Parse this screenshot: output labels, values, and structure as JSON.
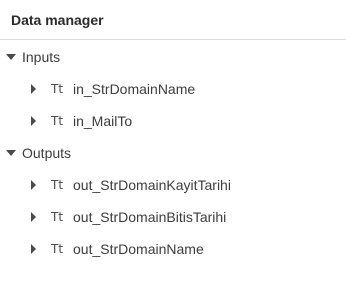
{
  "panel": {
    "title": "Data manager"
  },
  "groups": [
    {
      "label": "Inputs",
      "items": [
        {
          "type_icon": "Tt",
          "name": "in_StrDomainName"
        },
        {
          "type_icon": "Tt",
          "name": "in_MailTo"
        }
      ]
    },
    {
      "label": "Outputs",
      "items": [
        {
          "type_icon": "Tt",
          "name": "out_StrDomainKayitTarihi"
        },
        {
          "type_icon": "Tt",
          "name": "out_StrDomainBitisTarihi"
        },
        {
          "type_icon": "Tt",
          "name": "out_StrDomainName"
        }
      ]
    }
  ]
}
